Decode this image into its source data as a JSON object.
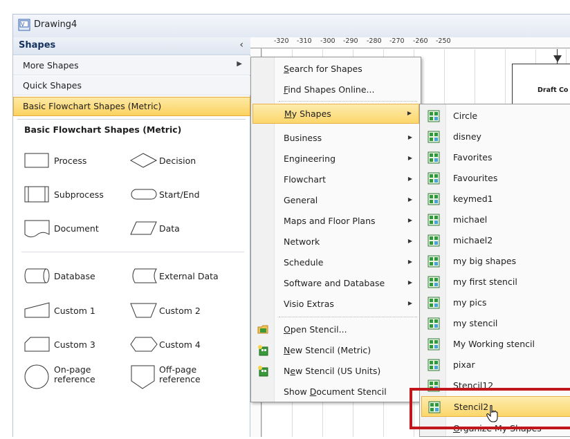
{
  "window": {
    "title": "Drawing4"
  },
  "shapes_pane": {
    "header": "Shapes",
    "rows": [
      {
        "label": "More Shapes",
        "has_submenu": true
      },
      {
        "label": "Quick Shapes",
        "has_submenu": false
      },
      {
        "label": "Basic Flowchart Shapes (Metric)",
        "has_submenu": false,
        "selected": true
      }
    ],
    "stencil_title": "Basic Flowchart Shapes (Metric)",
    "shapes": [
      {
        "label": "Process",
        "icon": "process-shape-icon"
      },
      {
        "label": "Decision",
        "icon": "decision-shape-icon"
      },
      {
        "label": "Subprocess",
        "icon": "subprocess-shape-icon"
      },
      {
        "label": "Start/End",
        "icon": "start-end-shape-icon"
      },
      {
        "label": "Document",
        "icon": "document-shape-icon"
      },
      {
        "label": "Data",
        "icon": "data-shape-icon"
      },
      {
        "label": "Database",
        "icon": "database-shape-icon"
      },
      {
        "label": "External Data",
        "icon": "external-data-shape-icon"
      },
      {
        "label": "Custom 1",
        "icon": "custom1-shape-icon"
      },
      {
        "label": "Custom 2",
        "icon": "custom2-shape-icon"
      },
      {
        "label": "Custom 3",
        "icon": "custom3-shape-icon"
      },
      {
        "label": "Custom 4",
        "icon": "custom4-shape-icon"
      },
      {
        "label": "On-page reference",
        "icon": "on-page-reference-shape-icon"
      },
      {
        "label": "Off-page reference",
        "icon": "off-page-reference-shape-icon"
      }
    ]
  },
  "ruler": {
    "ticks": [
      "-320",
      "-310",
      "-300",
      "-290",
      "-280",
      "-270",
      "-260",
      "-250"
    ]
  },
  "canvas": {
    "shape_text": "Draft Co"
  },
  "more_shapes_menu": {
    "items": [
      {
        "label": "Search for Shapes",
        "mnemonic": "S",
        "rest": "earch for Shapes",
        "submenu": false
      },
      {
        "label": "Find Shapes Online...",
        "mnemonic": "F",
        "rest": "ind Shapes Online...",
        "submenu": false
      },
      {
        "label": "My Shapes",
        "mnemonic": "M",
        "rest": "y Shapes",
        "submenu": true,
        "highlighted": true
      },
      {
        "label": "Business",
        "submenu": true
      },
      {
        "label": "Engineering",
        "submenu": true
      },
      {
        "label": "Flowchart",
        "submenu": true
      },
      {
        "label": "General",
        "submenu": true
      },
      {
        "label": "Maps and Floor Plans",
        "submenu": true
      },
      {
        "label": "Network",
        "submenu": true
      },
      {
        "label": "Schedule",
        "submenu": true
      },
      {
        "label": "Software and Database",
        "submenu": true
      },
      {
        "label": "Visio Extras",
        "submenu": true
      },
      {
        "label": "Open Stencil...",
        "mnemonic": "O",
        "rest": "pen Stencil...",
        "icon": "open-stencil-icon"
      },
      {
        "label": "New Stencil (Metric)",
        "mnemonic": "N",
        "rest": "ew Stencil (Metric)",
        "icon": "new-stencil-icon"
      },
      {
        "label": "New Stencil (US Units)",
        "pre": "N",
        "mnemonic": "e",
        "rest": "w Stencil (US Units)",
        "icon": "new-stencil-icon"
      },
      {
        "label": "Show Document Stencil",
        "pre": "Show ",
        "mnemonic": "D",
        "rest": "ocument Stencil"
      }
    ]
  },
  "my_shapes_menu": {
    "items": [
      {
        "label": "Circle"
      },
      {
        "label": "disney"
      },
      {
        "label": "Favorites"
      },
      {
        "label": "Favourites"
      },
      {
        "label": "keymed1"
      },
      {
        "label": "michael"
      },
      {
        "label": "michael2"
      },
      {
        "label": "my big shapes"
      },
      {
        "label": "my first stencil"
      },
      {
        "label": "my pics"
      },
      {
        "label": "my stencil"
      },
      {
        "label": "My Working stencil"
      },
      {
        "label": "pixar"
      },
      {
        "label": "Stencil12"
      },
      {
        "label": "Stencil2",
        "highlighted": true
      }
    ],
    "footer": {
      "label": "Organize My Shapes",
      "mnemonic": "O",
      "rest": "rganize My Shapes"
    }
  },
  "colors": {
    "highlight": "#fbd66a",
    "callout": "#c0161c",
    "stencil_icon": "#2f9a3a"
  }
}
